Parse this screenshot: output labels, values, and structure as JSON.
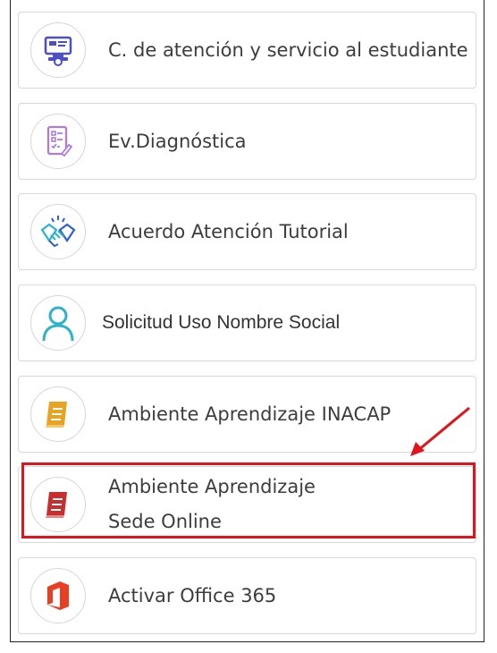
{
  "items": [
    {
      "label": "C. de atención y servicio al estudiante",
      "icon": "student-service-icon"
    },
    {
      "label": "Ev.Diagnóstica",
      "icon": "checklist-icon"
    },
    {
      "label": "Acuerdo Atención Tutorial",
      "icon": "handshake-icon"
    },
    {
      "label": "Solicitud Uso Nombre Social",
      "icon": "user-icon"
    },
    {
      "label": "Ambiente Aprendizaje INACAP",
      "icon": "book-yellow-icon"
    },
    {
      "label_line1": "Ambiente Aprendizaje",
      "label_line2": "Sede Online",
      "icon": "book-red-icon"
    },
    {
      "label": "Activar Office 365",
      "icon": "office-icon"
    }
  ],
  "colors": {
    "highlight": "#e0141a",
    "blue_icon": "#4d4fc8",
    "purple_icon": "#b07be0",
    "teal_icon": "#2bb3c9",
    "yellow_book": "#e7a422",
    "red_book": "#c92e2e",
    "office": "#ea3e23"
  }
}
